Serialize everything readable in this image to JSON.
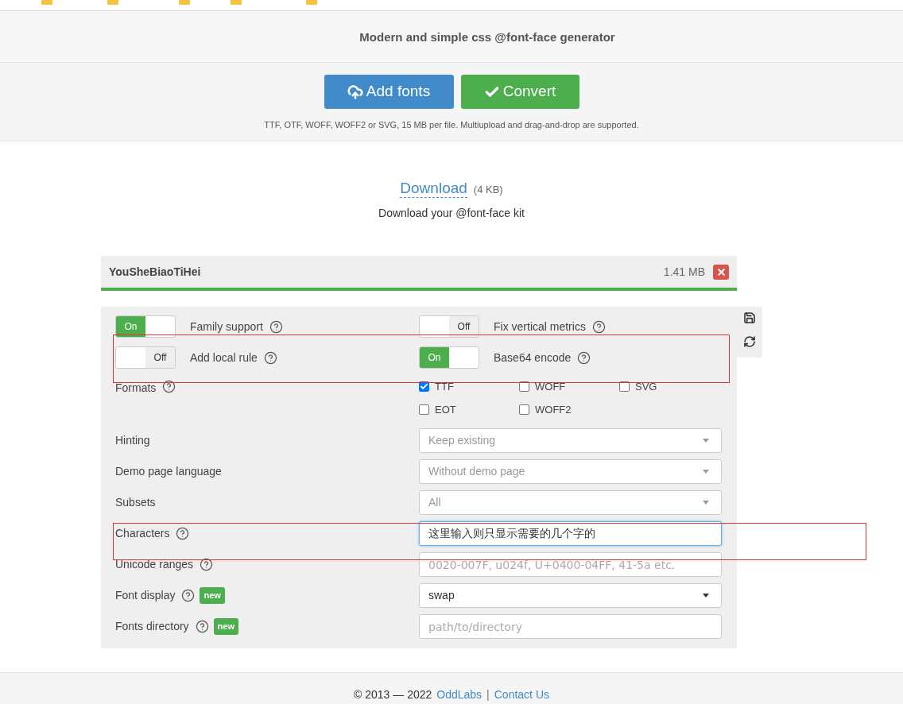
{
  "header": {
    "subtitle": "Modern and simple css @font-face generator"
  },
  "actions": {
    "buttons": [
      {
        "label": "Add fonts",
        "kind": "upload"
      },
      {
        "label": "Convert",
        "kind": "convert"
      }
    ],
    "note": "TTF, OTF, WOFF, WOFF2 or SVG, 15 MB per file. Multiupload and drag-and-drop are supported."
  },
  "download": {
    "link": "Download",
    "size": "(4 KB)",
    "caption": "Download your @font-face kit"
  },
  "font": {
    "name": "YouSheBiaoTiHei",
    "size": "1.41 MB"
  },
  "toggles": [
    {
      "label": "Family support",
      "on": true,
      "state_text": "On"
    },
    {
      "label": "Fix vertical metrics",
      "on": false,
      "state_text": "Off"
    },
    {
      "label": "Add local rule",
      "on": false,
      "state_text": "Off"
    },
    {
      "label": "Base64 encode",
      "on": true,
      "state_text": "On"
    }
  ],
  "formats": {
    "label": "Formats",
    "options": [
      {
        "label": "TTF",
        "checked": true
      },
      {
        "label": "WOFF",
        "checked": false
      },
      {
        "label": "SVG",
        "checked": false
      },
      {
        "label": "EOT",
        "checked": false
      },
      {
        "label": "WOFF2",
        "checked": false
      }
    ]
  },
  "fields": [
    {
      "label": "Hinting",
      "kind": "select",
      "value": "Keep existing",
      "disabled": true,
      "help": false
    },
    {
      "label": "Demo page language",
      "kind": "select",
      "value": "Without demo page",
      "disabled": true,
      "help": false
    },
    {
      "label": "Subsets",
      "kind": "select",
      "value": "All",
      "disabled": true,
      "help": false
    },
    {
      "label": "Characters",
      "kind": "input",
      "value": "这里输入则只显示需要的几个字的",
      "focused": true,
      "help": true
    },
    {
      "label": "Unicode ranges",
      "kind": "input",
      "placeholder": "0020-007F, u024f, U+0400-04FF, 41-5a etc.",
      "help": true
    },
    {
      "label": "Font display",
      "kind": "select",
      "value": "swap",
      "disabled": false,
      "help": true,
      "badge": "new"
    },
    {
      "label": "Fonts directory",
      "kind": "input",
      "placeholder": "path/to/directory",
      "help": true,
      "badge": "new"
    }
  ],
  "footer": {
    "copyright": "© 2013 — 2022",
    "links": [
      "OddLabs",
      "Contact Us"
    ],
    "separator": "|"
  }
}
